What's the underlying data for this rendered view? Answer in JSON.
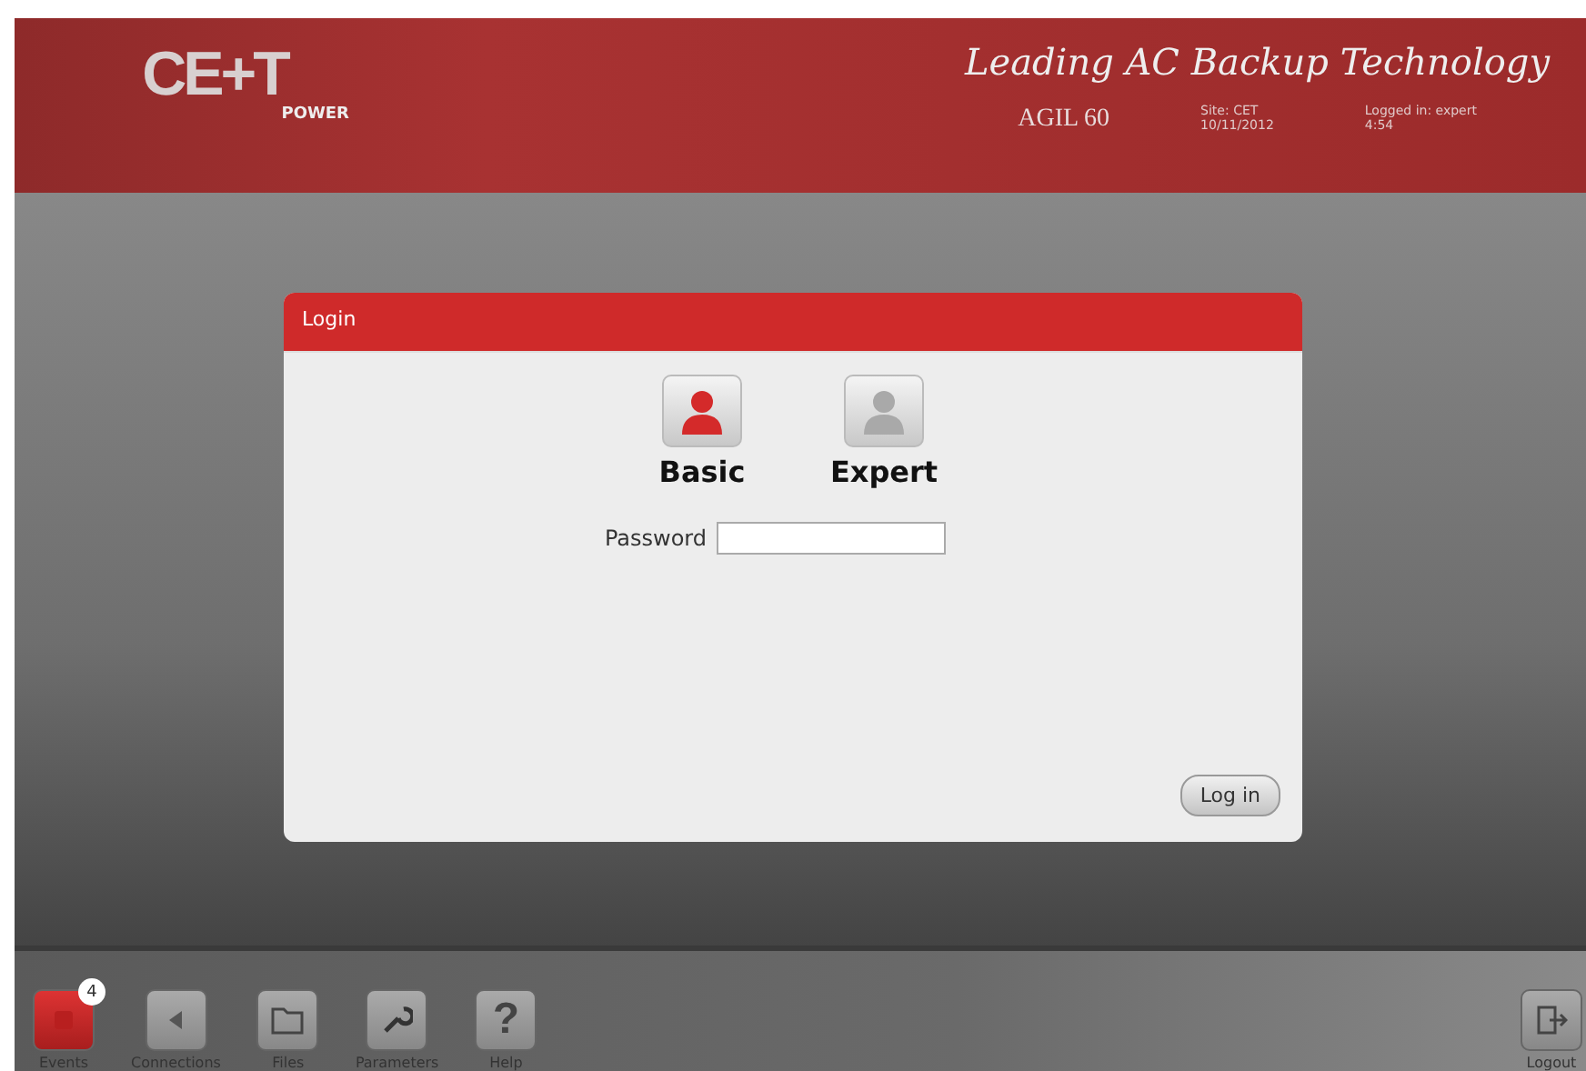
{
  "header": {
    "logo": "CE+T",
    "logo_sub": "POWER",
    "slogan": "Leading AC Backup Technology",
    "product": "AGIL 60",
    "site": [
      "Site: CET",
      "10/11/2012"
    ],
    "login_info": [
      "Logged in: expert",
      "4:54"
    ]
  },
  "dialog": {
    "title": "Login",
    "users": [
      {
        "label": "Basic",
        "selected": true
      },
      {
        "label": "Expert",
        "selected": false
      }
    ],
    "password": {
      "label": "Password"
    },
    "button": "Log in"
  },
  "toolbar": [
    {
      "label": "Events",
      "kind": "events",
      "badge": "4",
      "selected": true
    },
    {
      "label": "Connections",
      "kind": "connections",
      "selected": false
    },
    {
      "label": "Files",
      "kind": "files",
      "selected": false
    },
    {
      "label": "Parameters",
      "kind": "parameters",
      "selected": false
    },
    {
      "label": "Help",
      "kind": "help",
      "icon": "?",
      "selected": false
    }
  ],
  "logout": {
    "label": "Logout"
  }
}
